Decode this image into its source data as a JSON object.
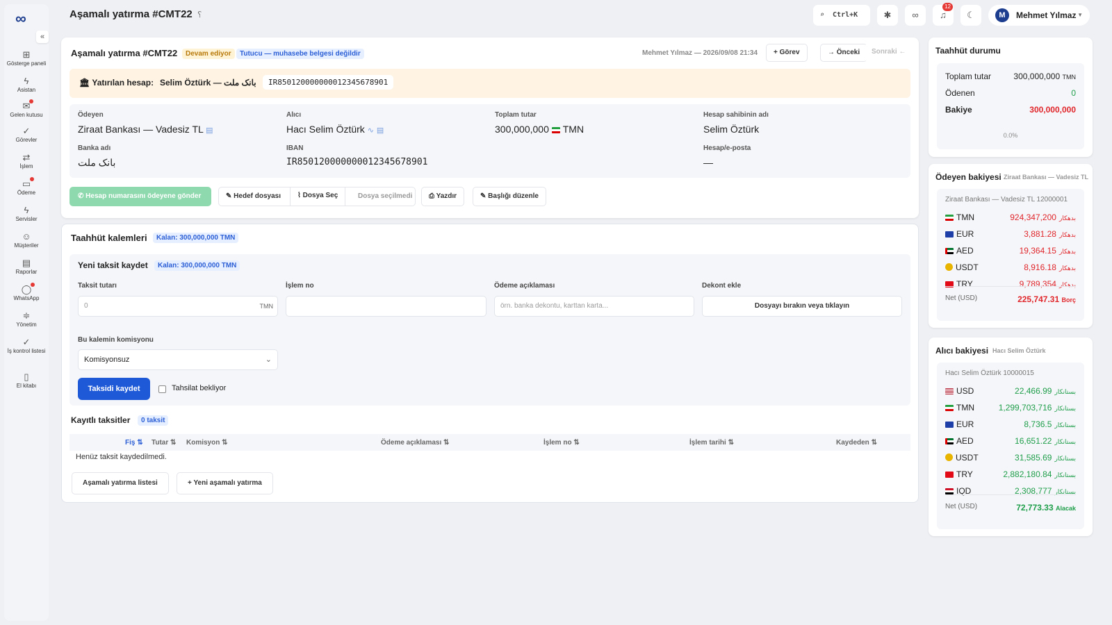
{
  "colors": {
    "accent": "#1e5ad8",
    "positive": "#1e9e4a",
    "negative": "#e0262b",
    "warning_bg": "#fff3e3"
  },
  "sidebar": {
    "items": [
      {
        "icon": "dashboard-icon",
        "label": "Gösterge paneli"
      },
      {
        "icon": "bolt-icon",
        "label": "Asistan"
      },
      {
        "icon": "inbox-icon",
        "label": "Gelen kutusu"
      },
      {
        "icon": "check-icon",
        "label": "Görevler"
      },
      {
        "icon": "swap-icon",
        "label": "İşlem"
      },
      {
        "icon": "payment-icon",
        "label": "Ödeme"
      },
      {
        "icon": "bolt-icon",
        "label": "Servisler"
      },
      {
        "icon": "users-icon",
        "label": "Müşteriler"
      },
      {
        "icon": "report-icon",
        "label": "Raporlar"
      },
      {
        "icon": "chat-icon",
        "label": "WhatsApp"
      },
      {
        "icon": "sliders-icon",
        "label": "Yönetim"
      },
      {
        "icon": "check-icon",
        "label": "İş kontrol listesi"
      },
      {
        "icon": "book-icon",
        "label": "El kitabı"
      }
    ]
  },
  "topbar": {
    "title": "Aşamalı yatırma #CMT22",
    "help": "؟",
    "search_shortcut": "Ctrl+K",
    "notifications": "12",
    "user_initial": "M",
    "user_name": "Mehmet Yılmaz"
  },
  "header": {
    "title": "Aşamalı yatırma #CMT22",
    "status": "Devam ediyor",
    "status2": "Tutucu — muhasebe belgesi değildir",
    "meta": "Mehmet Yılmaz — 2026/09/08 21:34",
    "task_btn": "+ Görev",
    "prev_btn": "→ Önceki",
    "next_btn": "Sonraki ←"
  },
  "account": {
    "label": "Yatırılan hesap:",
    "value": "Selim Öztürk — بانک ملت",
    "iban": "IR850120000000012345678901"
  },
  "info": {
    "payer_label": "Ödeyen",
    "payer": "Ziraat Bankası — Vadesiz TL",
    "receiver_label": "Alıcı",
    "receiver": "Hacı Selim Öztürk",
    "total_label": "Toplam tutar",
    "total": "300,000,000",
    "total_cur": "TMN",
    "holder_label": "Hesap sahibinin adı",
    "holder": "Selim Öztürk",
    "bank_label": "Banka adı",
    "bank": "بانک ملت",
    "iban_label": "IBAN",
    "iban": "IR850120000000012345678901",
    "email_label": "Hesap/e-posta",
    "email": "—"
  },
  "actions": {
    "whatsapp": "Hesap numarasını ödeyene gönder",
    "target_file": "Hedef dosyası",
    "choose_file": "Dosya Seç",
    "no_file": "Dosya seçilmedi",
    "print": "Yazdır",
    "edit_title": "Başlığı düzenle"
  },
  "commitments": {
    "title": "Taahhüt kalemleri",
    "remaining": "Kalan: 300,000,000 TMN"
  },
  "new_installment": {
    "title": "Yeni taksit kaydet",
    "remaining": "Kalan: 300,000,000 TMN",
    "amount_label": "Taksit tutarı",
    "amount_placeholder": "0",
    "amount_unit": "TMN",
    "txn_label": "İşlem no",
    "txn_value": "",
    "desc_label": "Ödeme açıklaması",
    "desc_placeholder": "örn. banka dekontu, karttan karta...",
    "receipt_label": "Dekont ekle",
    "drop_text": "Dosyayı bırakın veya tıklayın",
    "commission_label": "Bu kalemin komisyonu",
    "commission_value": "Komisyonsuz",
    "save_btn": "Taksidi kaydet",
    "pending_label": "Tahsilat bekliyor"
  },
  "saved": {
    "title": "Kayıtlı taksitler",
    "count": "0 taksit",
    "columns": [
      "Fiş ⇅",
      "Tutar ⇅",
      "Komisyon ⇅",
      "Ödeme açıklaması ⇅",
      "İşlem no ⇅",
      "İşlem tarihi ⇅",
      "Kaydeden ⇅"
    ],
    "empty": "Henüz taksit kaydedilmedi.",
    "list_btn": "Aşamalı yatırma listesi",
    "new_btn": "+ Yeni aşamalı yatırma"
  },
  "commit_status": {
    "title": "Taahhüt durumu",
    "total_label": "Toplam tutar",
    "total": "300,000,000",
    "total_cur": "TMN",
    "paid_label": "Ödenen",
    "paid": "0",
    "balance_label": "Bakiye",
    "balance": "300,000,000",
    "percent": "0.0%"
  },
  "payer_balance": {
    "title": "Ödeyen bakiyesi",
    "subtitle": "Ziraat Bankası — Vadesiz TL",
    "account": "Ziraat Bankası — Vadesiz TL 12000001",
    "rows": [
      {
        "cur": "TMN",
        "amount": "924,347,200",
        "dir": "بدهکار"
      },
      {
        "cur": "EUR",
        "amount": "3,881.28",
        "dir": "بدهکار"
      },
      {
        "cur": "AED",
        "amount": "19,364.15",
        "dir": "بدهکار"
      },
      {
        "cur": "USDT",
        "amount": "8,916.18",
        "dir": "بدهکار"
      },
      {
        "cur": "TRY",
        "amount": "9,789,354",
        "dir": "بدهکار"
      }
    ],
    "net_label": "Net (USD)",
    "net": "225,747.31",
    "net_dir": "Borç"
  },
  "receiver_balance": {
    "title": "Alıcı bakiyesi",
    "subtitle": "Hacı Selim Öztürk",
    "account": "Hacı Selim Öztürk 10000015",
    "rows": [
      {
        "cur": "USD",
        "amount": "22,466.99",
        "dir": "بستانکار"
      },
      {
        "cur": "TMN",
        "amount": "1,299,703,716",
        "dir": "بستانکار"
      },
      {
        "cur": "EUR",
        "amount": "8,736.5",
        "dir": "بستانکار"
      },
      {
        "cur": "AED",
        "amount": "16,651.22",
        "dir": "بستانکار"
      },
      {
        "cur": "USDT",
        "amount": "31,585.69",
        "dir": "بستانکار"
      },
      {
        "cur": "TRY",
        "amount": "2,882,180.84",
        "dir": "بستانکار"
      },
      {
        "cur": "IQD",
        "amount": "2,308,777",
        "dir": "بستانکار"
      }
    ],
    "net_label": "Net (USD)",
    "net": "72,773.33",
    "net_dir": "Alacak"
  }
}
